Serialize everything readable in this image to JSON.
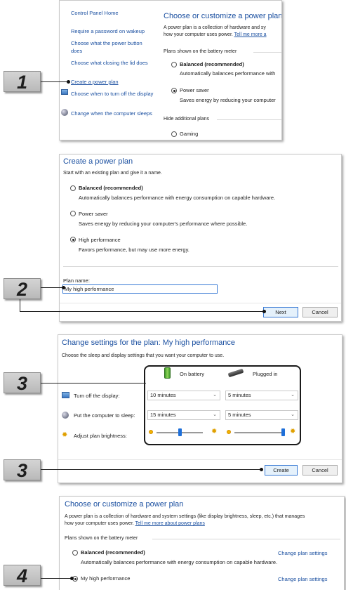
{
  "steps": [
    "1",
    "2",
    "3",
    "3",
    "4"
  ],
  "panel1": {
    "sidebar": {
      "home": "Control Panel Home",
      "items": [
        "Require a password on wakeup",
        "Choose what the power button does",
        "Choose what closing the lid does",
        "Create a power plan",
        "Choose when to turn off the display",
        "Change when the computer sleeps"
      ]
    },
    "title": "Choose or customize a power plan",
    "desc_line1": "A power plan is a collection of hardware and sy",
    "desc_line2": "how your computer uses power.",
    "desc_link": "Tell me more a",
    "battery_meter_label": "Plans shown on the battery meter",
    "plans": [
      {
        "name": "Balanced (recommended)",
        "desc": "Automatically balances performance with",
        "selected": false
      },
      {
        "name": "Power saver",
        "desc": "Saves energy by reducing your computer",
        "selected": true
      }
    ],
    "hide_additional": "Hide additional plans",
    "extra_plan": "Gaming"
  },
  "panel2": {
    "title": "Create a power plan",
    "subtitle": "Start with an existing plan and give it a name.",
    "plans": [
      {
        "name": "Balanced (recommended)",
        "desc": "Automatically balances performance with energy consumption on capable hardware.",
        "selected": false
      },
      {
        "name": "Power saver",
        "desc": "Saves energy by reducing your computer's performance where possible.",
        "selected": false
      },
      {
        "name": "High performance",
        "desc": "Favors performance, but may use more energy.",
        "selected": true
      }
    ],
    "plan_name_label": "Plan name:",
    "plan_name_value": "My high performance",
    "next": "Next",
    "cancel": "Cancel"
  },
  "panel3": {
    "title": "Change settings for the plan: My high performance",
    "subtitle": "Choose the sleep and display settings that you want your computer to use.",
    "on_battery": "On battery",
    "plugged_in": "Plugged in",
    "rows": [
      {
        "label": "Turn off the display:",
        "battery": "10 minutes",
        "plugged": "5 minutes"
      },
      {
        "label": "Put the computer to sleep:",
        "battery": "15 minutes",
        "plugged": "5 minutes"
      }
    ],
    "brightness_label": "Adjust plan brightness:",
    "brightness_battery": 0.5,
    "brightness_plugged": 1.0,
    "create": "Create",
    "cancel": "Cancel"
  },
  "panel4": {
    "title": "Choose or customize a power plan",
    "desc_line1": "A power plan is a collection of hardware and system settings (like display brightness, sleep, etc.) that manages",
    "desc_line2": "how your computer uses power.",
    "desc_link": "Tell me more about power plans",
    "battery_meter_label": "Plans shown on the battery meter",
    "plans": [
      {
        "name": "Balanced (recommended)",
        "desc": "Automatically balances performance with energy consumption on capable hardware.",
        "selected": false,
        "change": "Change plan settings"
      },
      {
        "name": "My high performance",
        "selected": true,
        "change": "Change plan settings"
      }
    ]
  },
  "colors": {
    "link": "#1a4fa0",
    "accent": "#3a7bd5"
  }
}
